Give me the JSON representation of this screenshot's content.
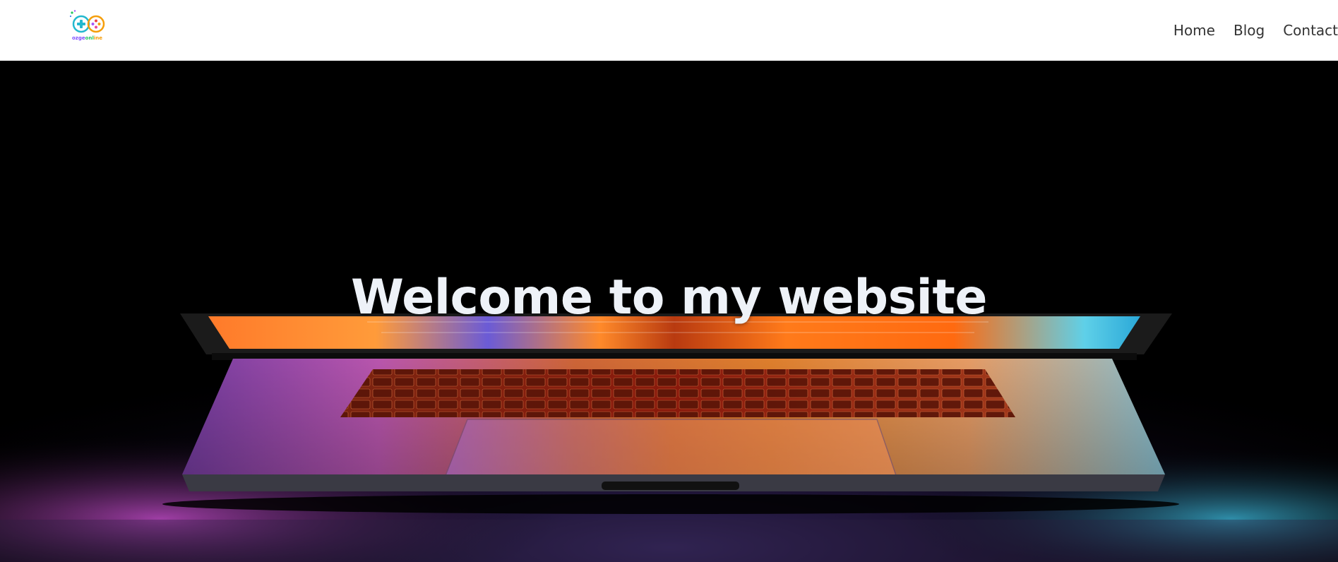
{
  "header": {
    "logo": {
      "text_part1": "ozge",
      "text_part2": "onl",
      "text_part3": "ine",
      "icon": "gamepad-logo-icon"
    },
    "nav": [
      {
        "label": "Home"
      },
      {
        "label": "Blog"
      },
      {
        "label": "Contact"
      }
    ]
  },
  "hero": {
    "title": "Welcome to my website",
    "background_image": "laptop-glow-image"
  },
  "colors": {
    "header_bg": "#ffffff",
    "nav_text": "#333333",
    "hero_bg": "#000000",
    "hero_title": "#eef2f8"
  }
}
